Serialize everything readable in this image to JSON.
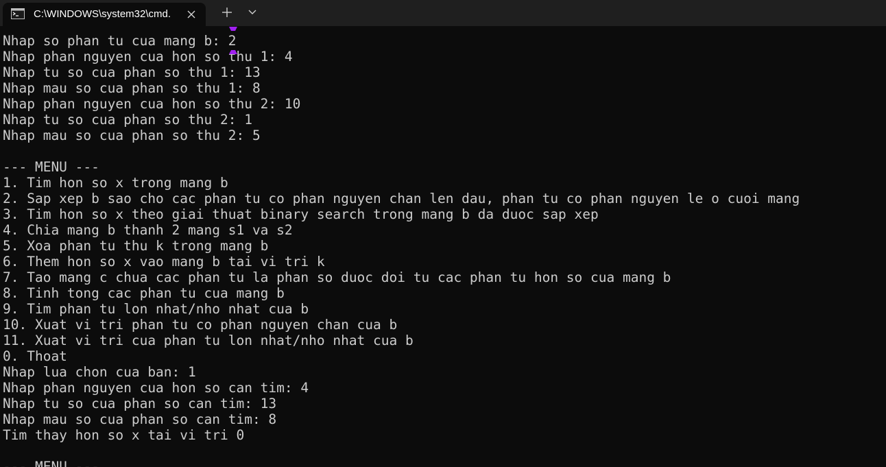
{
  "tab": {
    "title": "C:\\WINDOWS\\system32\\cmd.",
    "icon": "cmd-icon"
  },
  "toolbar": {
    "new_tab_icon": "plus-icon",
    "dropdown_icon": "chevron-down-icon"
  },
  "console": {
    "lines": [
      "Nhap so phan tu cua mang b: 2",
      "Nhap phan nguyen cua hon so thu 1: 4",
      "Nhap tu so cua phan so thu 1: 13",
      "Nhap mau so cua phan so thu 1: 8",
      "Nhap phan nguyen cua hon so thu 2: 10",
      "Nhap tu so cua phan so thu 2: 1",
      "Nhap mau so cua phan so thu 2: 5",
      "",
      "--- MENU ---",
      "1. Tim hon so x trong mang b",
      "2. Sap xep b sao cho cac phan tu co phan nguyen chan len dau, phan tu co phan nguyen le o cuoi mang",
      "3. Tim hon so x theo giai thuat binary search trong mang b da duoc sap xep",
      "4. Chia mang b thanh 2 mang s1 va s2",
      "5. Xoa phan tu thu k trong mang b",
      "6. Them hon so x vao mang b tai vi tri k",
      "7. Tao mang c chua cac phan tu la phan so duoc doi tu cac phan tu hon so cua mang b",
      "8. Tinh tong cac phan tu cua mang b",
      "9. Tim phan tu lon nhat/nho nhat cua b",
      "10. Xuat vi tri phan tu co phan nguyen chan cua b",
      "11. Xuat vi tri cua phan tu lon nhat/nho nhat cua b",
      "0. Thoat",
      "Nhap lua chon cua ban: 1",
      "Nhap phan nguyen cua hon so can tim: 4",
      "Nhap tu so cua phan so can tim: 13",
      "Nhap mau so cua phan so can tim: 8",
      "Tim thay hon so x tai vi tri 0",
      "",
      "--- MENU ---"
    ]
  },
  "colors": {
    "background": "#0c0c0c",
    "titlebar": "#1f1f1f",
    "text": "#cccccc",
    "marker": "#a020f0"
  }
}
